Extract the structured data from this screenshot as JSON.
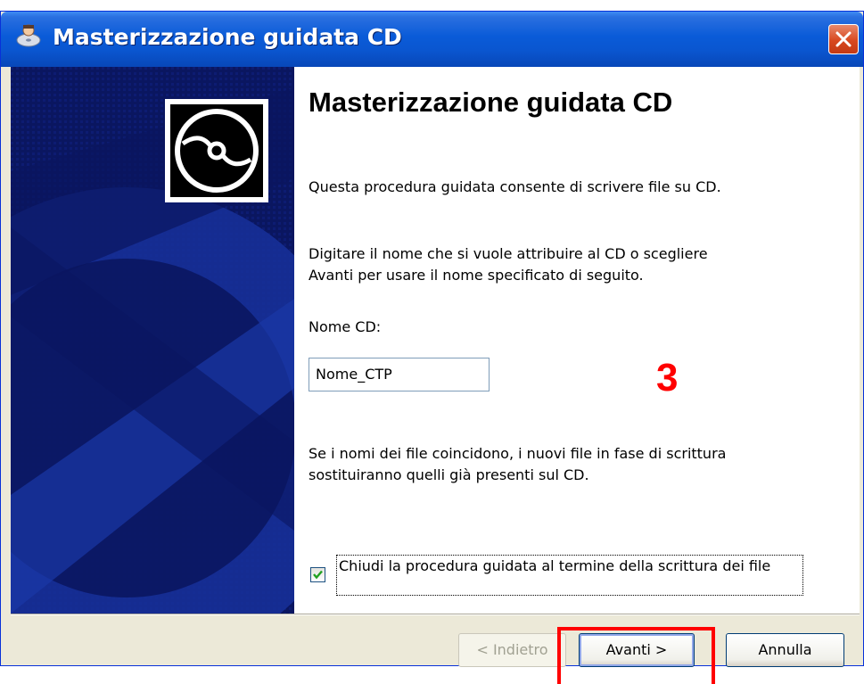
{
  "window": {
    "title": "Masterizzazione guidata CD",
    "title_icon": "cd-burn-icon",
    "close_icon": "close-icon"
  },
  "banner": {
    "icon": "cd-disc-icon"
  },
  "content": {
    "heading": "Masterizzazione guidata CD",
    "intro": "Questa procedura guidata consente di scrivere file su CD.",
    "instructions_line1": "Digitare il nome che si vuole attribuire al CD o scegliere",
    "instructions_line2": "Avanti per usare il nome specificato di seguito.",
    "name_label": "Nome CD:",
    "name_value": "Nome_CTP",
    "warning_line1": "Se i nomi dei file coincidono, i nuovi file in fase di scrittura",
    "warning_line2": "sostituiranno quelli già presenti sul CD.",
    "checkbox_label": "Chiudi la procedura guidata al termine della scrittura dei file",
    "checkbox_checked": true,
    "step_number": "3"
  },
  "buttons": {
    "back": "< Indietro",
    "next": "Avanti >",
    "cancel": "Annulla"
  },
  "colors": {
    "accent": "#0a56d0",
    "banner": "#0a1660",
    "highlight": "#ff0000"
  }
}
